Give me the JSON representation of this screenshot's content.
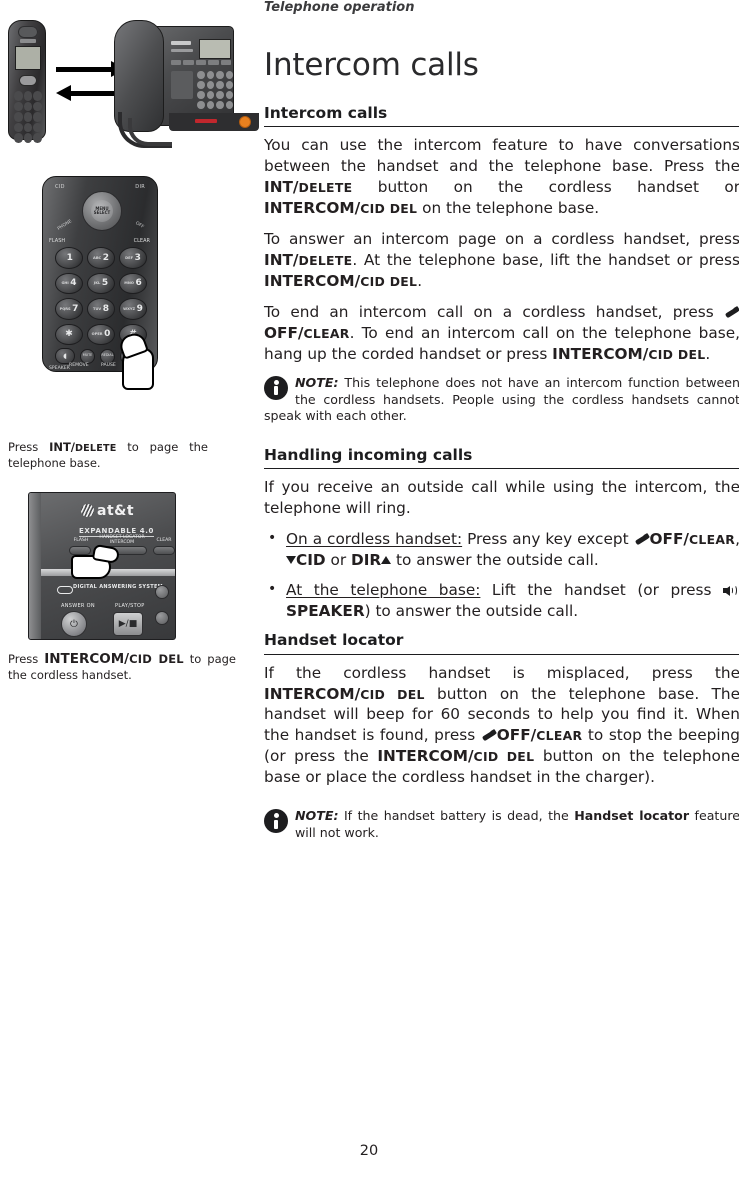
{
  "running_head": "Telephone operation",
  "chapter_title": "Intercom calls",
  "page_number": "20",
  "sections": {
    "intercom_calls": {
      "heading": "Intercom calls",
      "p1": {
        "t1": "You can use the intercom feature to have conversations between the handset and the telephone base. Press the ",
        "b1": "INT/",
        "sc1": "DELETE",
        "t2": " button on the cordless handset or ",
        "b2": "INTERCOM/",
        "sc2": "CID DEL",
        "t3": " on the telephone base."
      },
      "p2": {
        "t1": "To answer an intercom page on a cordless handset, press ",
        "b1": "INT/",
        "sc1": "DELETE",
        "t2": ". At the telephone base, lift the handset or press ",
        "b2": "INTERCOM/",
        "sc2": "CID DEL",
        "t3": "."
      },
      "p3": {
        "t1": "To end an intercom call on a cordless handset, press ",
        "b1": "OFF/",
        "sc1": "CLEAR",
        "t2": ". To end an intercom call on the telephone base, hang up the corded handset or press ",
        "b2": "INTERCOM/",
        "sc2": "CID DEL",
        "t3": "."
      },
      "note": {
        "label": "NOTE:",
        "text": " This telephone does not have an intercom function between the cordless handsets. People using the cordless handsets cannot speak with each other."
      }
    },
    "handling_incoming_calls": {
      "heading": "Handling incoming calls",
      "p1": "If you receive an outside call while using the intercom, the telephone will ring.",
      "bullets": [
        {
          "lead": "On a cordless handset:",
          "t1": " Press any key except ",
          "b1": "OFF/",
          "sc1": "CLEAR",
          "t2": ", ",
          "b2": "CID",
          "t3": " or ",
          "b3": "DIR",
          "t4": " to answer the outside call."
        },
        {
          "lead": "At the telephone base:",
          "t1": " Lift the handset (or press ",
          "b1": "SPEAKER",
          "t2": ") to answer the outside call."
        }
      ]
    },
    "handset_locator": {
      "heading": "Handset locator",
      "p1": {
        "t1": "If the cordless handset is misplaced, press the ",
        "b1": "INTERCOM/",
        "sc1": "CID DEL",
        "t2": " button on the telephone base. The handset will beep for 60 seconds to help you find it. When the handset is found, press ",
        "b2": "OFF/",
        "sc2": "CLEAR",
        "t3": " to stop the beeping (or press the ",
        "b3": "INTERCOM/",
        "sc3": "CID DEL",
        "t4": " button on the telephone base or place the cordless handset in the charger)."
      },
      "note": {
        "label": "NOTE:",
        "t1": "  If the handset battery is dead, the ",
        "b1": "Handset locator",
        "t2": " feature will not work."
      }
    }
  },
  "figures": {
    "handset_base": {
      "alt": "cordless handset and telephone base exchanging intercom calls"
    },
    "handset_keypad": {
      "alt": "cordless handset keypad with finger pressing INT button",
      "labels": {
        "cid": "CID",
        "dir": "DIR",
        "menu_select": "MENU SELECT",
        "flash": "FLASH",
        "clear": "CLEAR",
        "phone": "PHONE",
        "off": "OFF",
        "speaker": "SPEAKER",
        "remove": "REMOVE",
        "pause": "PAUSE",
        "mute": "MUTE",
        "redial": "REDIAL",
        "int": "INT",
        "keys": [
          {
            "num": "1",
            "letters": ""
          },
          {
            "num": "2",
            "letters": "ABC"
          },
          {
            "num": "3",
            "letters": "DEF"
          },
          {
            "num": "4",
            "letters": "GHI"
          },
          {
            "num": "5",
            "letters": "JKL"
          },
          {
            "num": "6",
            "letters": "MNO"
          },
          {
            "num": "7",
            "letters": "PQRS"
          },
          {
            "num": "8",
            "letters": "TUV"
          },
          {
            "num": "9",
            "letters": "WXYZ"
          },
          {
            "num": "✱",
            "letters": ""
          },
          {
            "num": "0",
            "letters": "OPER"
          },
          {
            "num": "#",
            "letters": ""
          }
        ]
      }
    },
    "base_closeup": {
      "alt": "telephone base with finger pressing HANDSET LOCATOR INTERCOM button",
      "labels": {
        "brand": "at&t",
        "expandable": "EXPANDABLE 4.0",
        "flash": "FLASH",
        "handset_locator": "HANDSET LOCATOR INTERCOM",
        "clear": "CLEAR",
        "das": "DIGITAL ANSWERING SYSTEM",
        "answer_on": "ANSWER ON",
        "play_stop": "PLAY/STOP",
        "play_glyph": "▶/■",
        "power_glyph": "⏻"
      }
    }
  },
  "captions": {
    "caption1": {
      "t1": "Press ",
      "b1": "INT/",
      "sc1": "DELETE",
      "t2": " to page the telephone base."
    },
    "caption2": {
      "t1": "Press ",
      "b1": "INTERCOM/",
      "sc1": "CID DEL",
      "t2": " to page the cordless handset."
    }
  }
}
